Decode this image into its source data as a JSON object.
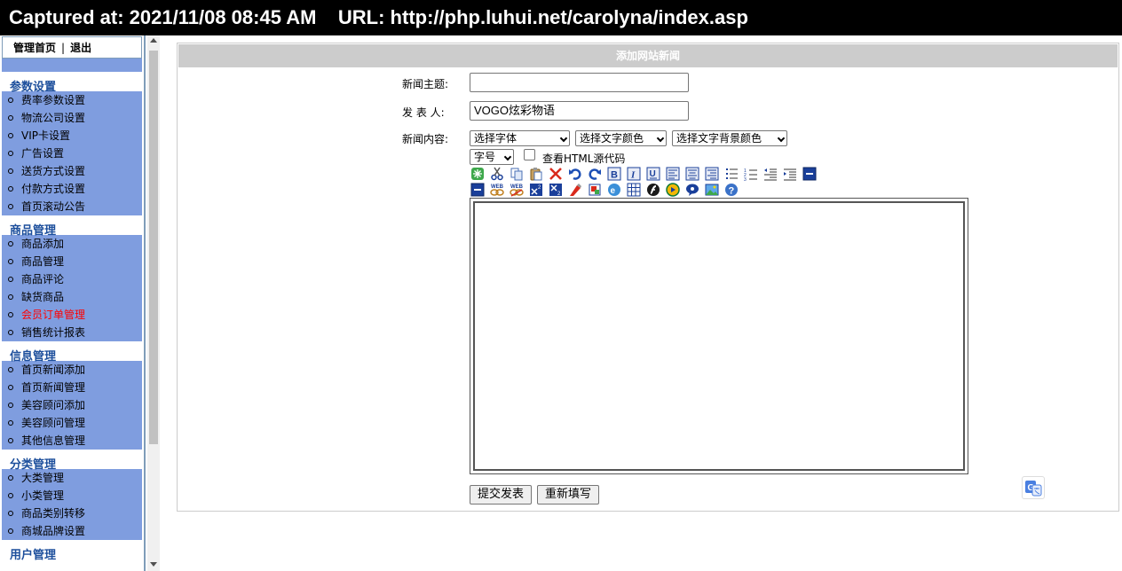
{
  "capture": {
    "text": "Captured at: 2021/11/08 08:45 AM    URL: http://php.luhui.net/carolyna/index.asp"
  },
  "sidebar": {
    "top_links": [
      "管理首页",
      "退出"
    ],
    "top_sep": "|",
    "sections": [
      {
        "title": "参数设置",
        "items": [
          "费率参数设置",
          "物流公司设置",
          "VIP卡设置",
          "广告设置",
          "送货方式设置",
          "付款方式设置",
          "首页滚动公告"
        ]
      },
      {
        "title": "商品管理",
        "items": [
          "商品添加",
          "商品管理",
          "商品评论",
          "缺货商品",
          "会员订单管理",
          "销售统计报表"
        ]
      },
      {
        "title": "信息管理",
        "items": [
          "首页新闻添加",
          "首页新闻管理",
          "美容顾问添加",
          "美容顾问管理",
          "其他信息管理"
        ]
      },
      {
        "title": "分类管理",
        "items": [
          "大类管理",
          "小类管理",
          "商品类别转移",
          "商城品牌设置"
        ]
      },
      {
        "title": "用户管理",
        "items": []
      }
    ],
    "active_item": "会员订单管理",
    "colors": {
      "item_bg": "#7f9ddf",
      "heading": "#1d4f9c",
      "active": "#ff0000"
    }
  },
  "form": {
    "title": "添加网站新闻",
    "subject_label": "新闻主题:",
    "subject_value": "",
    "author_label": "发 表 人:",
    "author_value": "VOGO炫彩物语",
    "content_label": "新闻内容:",
    "font_select": "选择字体",
    "color_select": "选择文字颜色",
    "bgcolor_select": "选择文字背景颜色",
    "size_select": "字号",
    "html_source_label": "查看HTML源代码",
    "submit": "提交发表",
    "reset": "重新填写"
  },
  "toolbar": {
    "row1": [
      "new-doc-icon",
      "cut-icon",
      "copy-icon",
      "paste-icon",
      "delete-icon",
      "undo-icon",
      "redo-icon",
      "bold-icon",
      "italic-icon",
      "underline-icon",
      "align-left-icon",
      "align-center-icon",
      "align-right-icon",
      "unordered-list-icon",
      "ordered-list-icon",
      "outdent-icon",
      "indent-icon",
      "horizontal-rule-icon"
    ],
    "row2": [
      "horizontal-rule-icon",
      "insert-link-icon",
      "remove-link-icon",
      "superscript-icon",
      "subscript-icon",
      "clean-format-icon",
      "insert-image-icon",
      "web-icon",
      "table-icon",
      "flash-icon",
      "media-icon",
      "sound-icon",
      "picture-icon",
      "help-icon"
    ]
  }
}
